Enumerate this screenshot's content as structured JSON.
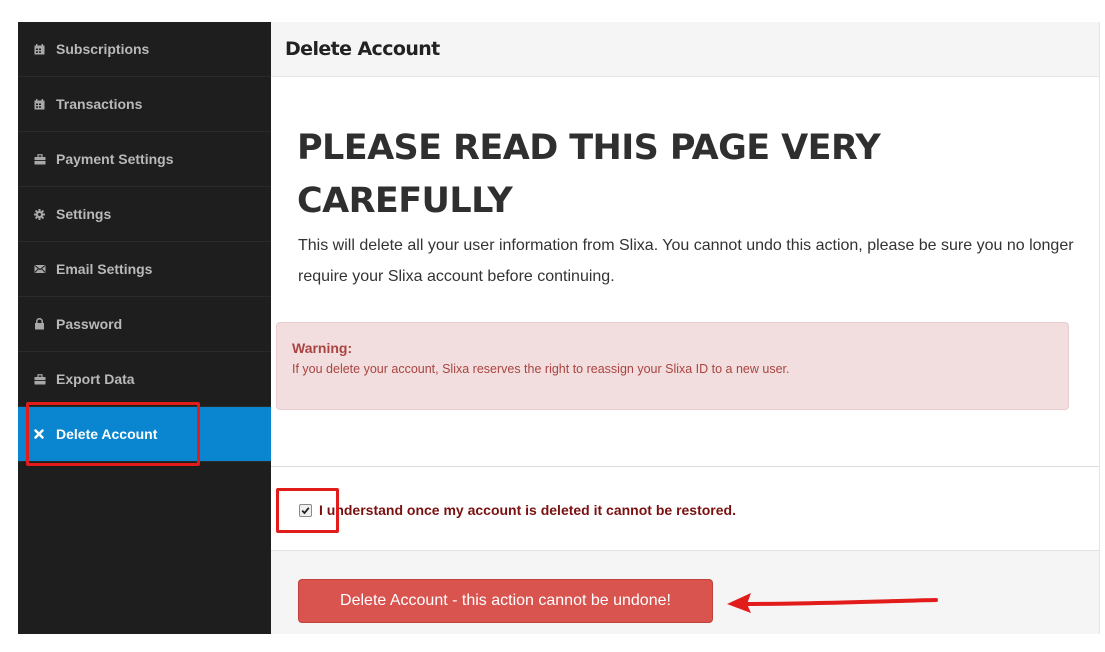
{
  "sidebar": {
    "items": [
      {
        "label": "Subscriptions",
        "icon": "calendar-icon"
      },
      {
        "label": "Transactions",
        "icon": "calendar-icon"
      },
      {
        "label": "Payment Settings",
        "icon": "briefcase-icon"
      },
      {
        "label": "Settings",
        "icon": "gear-icon"
      },
      {
        "label": "Email Settings",
        "icon": "envelope-icon"
      },
      {
        "label": "Password",
        "icon": "lock-icon"
      },
      {
        "label": "Export Data",
        "icon": "briefcase-icon"
      },
      {
        "label": "Delete Account",
        "icon": "close-icon",
        "active": true
      }
    ]
  },
  "panel": {
    "title": "Delete Account",
    "heading": "PLEASE READ THIS PAGE VERY CAREFULLY",
    "description": "This will delete all your user information from Slixa. You cannot undo this action, please be sure you no longer require your Slixa account before continuing."
  },
  "warning": {
    "title": "Warning:",
    "text": "If you delete your account, Slixa reserves the right to reassign your Slixa ID to a new user."
  },
  "confirm": {
    "label": "I understand once my account is deleted it cannot be restored.",
    "checked": true
  },
  "delete_button": {
    "label": "Delete Account - this action cannot be undone!"
  },
  "colors": {
    "sidebar_bg": "#1e1e1e",
    "active_bg": "#0a85cf",
    "danger": "#d9534f",
    "warning_bg": "#f2dede",
    "annotation": "#e21b1b"
  }
}
